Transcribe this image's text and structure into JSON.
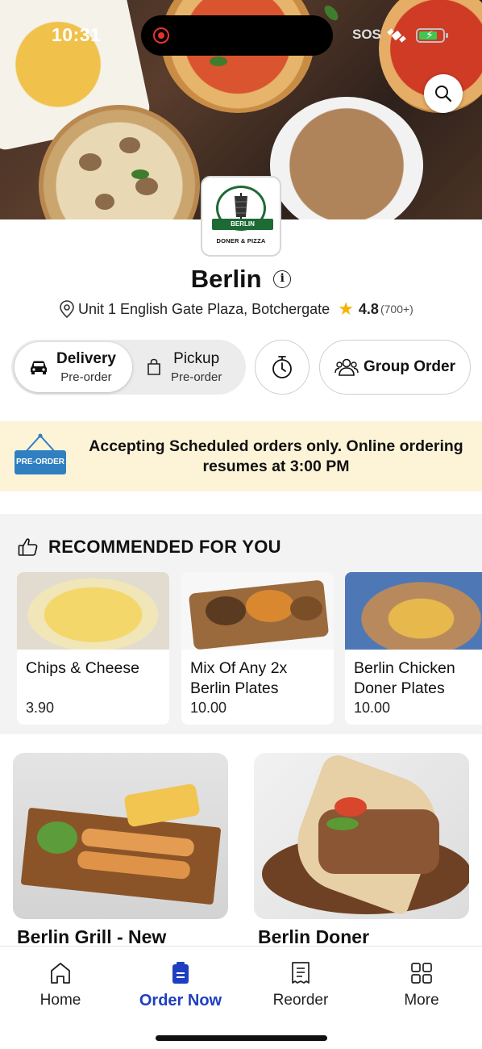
{
  "status_bar": {
    "time": "10:31",
    "carrier_label": "SOS"
  },
  "store": {
    "name": "Berlin",
    "logo_ribbon": "BERLIN",
    "logo_subtitle": "DONER & PIZZA",
    "address": "Unit 1 English Gate Plaza, Botchergate",
    "rating": "4.8",
    "rating_count": "(700+)"
  },
  "order_mode": {
    "delivery": {
      "title": "Delivery",
      "subtitle": "Pre-order",
      "selected": true
    },
    "pickup": {
      "title": "Pickup",
      "subtitle": "Pre-order",
      "selected": false
    },
    "group_order_label": "Group Order"
  },
  "banner": {
    "sign_text": "PRE-ORDER",
    "message": "Accepting Scheduled orders only. Online ordering resumes at 3:00 PM"
  },
  "recommended": {
    "heading": "RECOMMENDED FOR YOU",
    "items": [
      {
        "name": "Chips & Cheese",
        "price": "3.90"
      },
      {
        "name": "Mix Of Any 2x Berlin Plates",
        "price": "10.00"
      },
      {
        "name": "Berlin Chicken Doner Plates",
        "price": "10.00"
      }
    ]
  },
  "menu": {
    "items": [
      {
        "title": "Berlin Grill - New"
      },
      {
        "title": "Berlin Doner"
      }
    ]
  },
  "bottom_nav": {
    "items": [
      {
        "label": "Home",
        "icon": "home-icon"
      },
      {
        "label": "Order Now",
        "icon": "order-bag-icon",
        "active": true
      },
      {
        "label": "Reorder",
        "icon": "receipt-icon"
      },
      {
        "label": "More",
        "icon": "grid-icon"
      }
    ]
  },
  "colors": {
    "accent": "#1f3fc0",
    "banner_bg": "#fdf4d8",
    "star": "#f5b400",
    "logo_green": "#1d6b34"
  }
}
